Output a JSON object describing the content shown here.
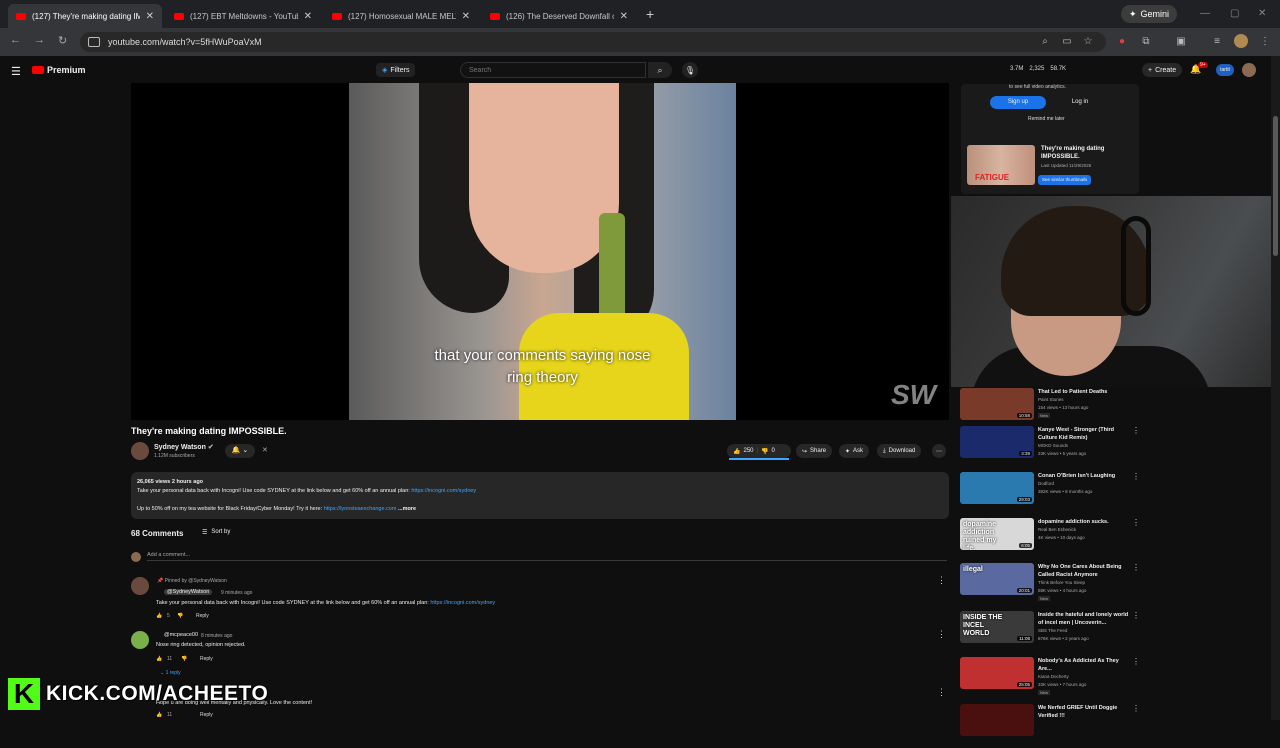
{
  "browser": {
    "tabs": [
      {
        "title": "(127) They're making dating IMP"
      },
      {
        "title": "(127) EBT Meltdowns - YouTube"
      },
      {
        "title": "(127) Homosexual MALE MELT"
      },
      {
        "title": "(126) The Deserved Downfall o"
      }
    ],
    "new_tab": "+",
    "gemini_label": "Gemini",
    "url": "youtube.com/watch?v=5fHWuPoaVxM"
  },
  "youtube": {
    "logo_text": "Premium",
    "filters_label": "Filters",
    "search_placeholder": "Search",
    "stats": [
      "3.7M",
      "2,325",
      "58.7K"
    ],
    "create_label": "Create",
    "notif_count": "9+",
    "chip_label": "tartit"
  },
  "video": {
    "subtitle_line1": "that your comments saying nose",
    "subtitle_line2": "ring theory",
    "watermark": "SW",
    "title": "They're making dating IMPOSSIBLE.",
    "channel": "Sydney Watson",
    "subscribers": "1.12M subscribers",
    "likes": "250",
    "dislikes": "0",
    "share": "Share",
    "ask": "Ask",
    "download": "Download",
    "like_ratio": 1.0
  },
  "description": {
    "meta": "26,065 views  2 hours ago",
    "line1": "Take your personal data back with Incogni! Use code SYDNEY at the link below and get 60% off an annual plan:",
    "link1": "https://incogni.com/sydney",
    "line2": "Up to 50% off on my tea website for Black Friday/Cyber Monday! Try it here:",
    "link2": "https://lyonsteaexchange.com",
    "more": "...more"
  },
  "comments": {
    "count_label": "68 Comments",
    "sort_label": "Sort by",
    "add_placeholder": "Add a comment...",
    "items": [
      {
        "pinned": "Pinned by @SydneyWatson",
        "author": "@SydneyWatson",
        "time": "9 minutes ago",
        "text": "Take your personal data back with Incogni! Use code SYDNEY at the link below and get 60% off an annual plan:",
        "link": "https://incogni.com/sydney",
        "likes": "5",
        "reply": "Reply"
      },
      {
        "author": "@mcpeace00",
        "time": "8 minutes ago",
        "text": "Nose ring detected, opinion rejected.",
        "likes": "11",
        "reply": "Reply",
        "replies": "1 reply"
      },
      {
        "text": "Hope u are doing well mentally and physically. Love the content!",
        "likes": "11",
        "reply": "Reply"
      }
    ]
  },
  "sidebar": {
    "analytics_text": "to see full video analytics.",
    "signup": "Sign up",
    "login": "Log in",
    "remind": "Remind me later",
    "promo_title": "They're making dating IMPOSSIBLE.",
    "promo_thumb_label": "FATIGUE",
    "promo_updated": "Last Updated 11/29/2025",
    "promo_button": "See similar thumbnails",
    "recs": [
      {
        "title": "That Led to Patient Deaths",
        "channel": "Paint Stories",
        "views": "154 views • 13 hours ago",
        "badge": "New",
        "duration": "10:58",
        "color": "#7a3a2a"
      },
      {
        "title": "Kanye West - Stronger (Third Culture Kid Remix)",
        "channel": "MGKD Sounds",
        "views": "23K views • 5 years ago",
        "duration": "3:39",
        "color": "#1a2a6a"
      },
      {
        "title": "Conan O'Brien Isn't Laughing",
        "channel": "Dodford",
        "views": "382K views • 8 months ago",
        "duration": "29:03",
        "color": "#2a7ab0"
      },
      {
        "title": "dopamine addiction sucks.",
        "channel": "Real Ben Eshenick",
        "views": "4K views • 10 days ago",
        "duration": "6:05",
        "color": "#d8d8d8",
        "thumb_text": "dopamine addiction ruined my life."
      },
      {
        "title": "Why No One Cares About Being Called Racist Anymore",
        "channel": "Think Before You Sleep",
        "views": "58K views • 4 hours ago",
        "badge": "New",
        "duration": "20:01",
        "color": "#5a6aa0",
        "thumb_text": "illegal"
      },
      {
        "title": "Inside the hateful and lonely world of incel men | Uncoverin...",
        "channel": "SBS The Feed",
        "views": "876K views • 2 years ago",
        "duration": "11:08",
        "color": "#3a3a3a",
        "thumb_text": "INSIDE THE INCEL WORLD"
      },
      {
        "title": "Nobody's As Addicted As They Are...",
        "channel": "Kiana Docherty",
        "views": "33K views • 7 hours ago",
        "badge": "New",
        "duration": "25:05",
        "color": "#c03030"
      },
      {
        "title": "We Nerfed GRIEF Until Doggie Verified !!!",
        "channel": "",
        "views": "",
        "duration": "",
        "color": "#4a1010"
      }
    ]
  },
  "overlay": {
    "kick_logo": "K",
    "kick_text": "KICK.COM/ACHEETO"
  }
}
